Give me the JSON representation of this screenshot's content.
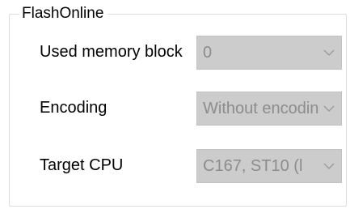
{
  "group": {
    "title": "FlashOnline"
  },
  "fields": [
    {
      "label": "Used memory block",
      "value": "0",
      "icon": "chevron-down-icon"
    },
    {
      "label": "Encoding",
      "value": "Without encoding",
      "icon": "chevron-down-icon"
    },
    {
      "label": "Target CPU",
      "value": "C167, ST10 (l",
      "icon": "chevron-down-icon"
    }
  ],
  "colors": {
    "disabled_field_bg": "#cccccc",
    "disabled_text": "#8c8c8c",
    "group_border": "#dcdcdc"
  }
}
